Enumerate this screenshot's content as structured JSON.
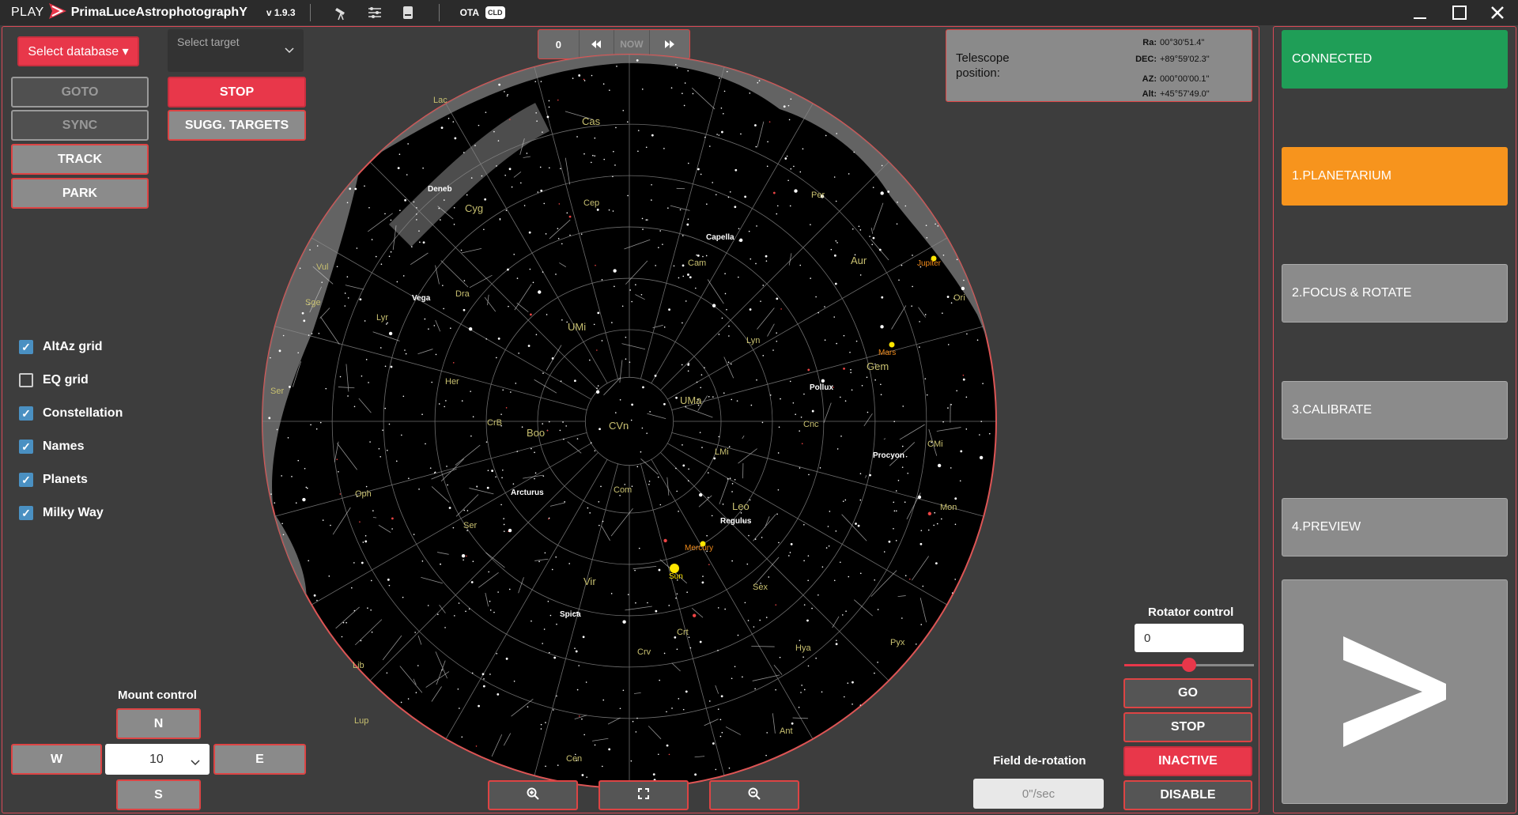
{
  "titlebar": {
    "play": "PLAY",
    "company": "PrimaLuceAstrophotographY",
    "version": "v 1.9.3",
    "ota": "OTA",
    "cld": "CLD"
  },
  "left": {
    "select_database": "Select database ▾",
    "select_target_placeholder": "Select target",
    "goto": "GOTO",
    "sync": "SYNC",
    "track": "TRACK",
    "park": "PARK",
    "stop": "STOP",
    "sugg_targets": "SUGG. TARGETS",
    "options": [
      {
        "label": "AltAz grid",
        "checked": true
      },
      {
        "label": "EQ grid",
        "checked": false
      },
      {
        "label": "Constellation",
        "checked": true
      },
      {
        "label": "Names",
        "checked": true
      },
      {
        "label": "Planets",
        "checked": true
      },
      {
        "label": "Milky Way",
        "checked": true
      }
    ],
    "mount_control": "Mount control",
    "n": "N",
    "s": "S",
    "w": "W",
    "e": "E",
    "speed_value": "10"
  },
  "timebar": {
    "count": "0",
    "now": "NOW"
  },
  "telescope": {
    "label": "Telescope position:",
    "ra_label": "Ra:",
    "ra": "00°30'51.4\"",
    "dec_label": "DEC:",
    "dec": "+89°59'02.3\"",
    "az_label": "AZ:",
    "az": "000°00'00.1\"",
    "alt_label": "Alt:",
    "alt": "+45°57'49.0\""
  },
  "sky_labels": {
    "constellations": [
      "Lac",
      "Cas",
      "Cyg",
      "Cep",
      "Per",
      "Cam",
      "Aur",
      "Vul",
      "Sge",
      "Lyr",
      "Dra",
      "UMi",
      "Lyn",
      "Ori",
      "Gem",
      "Her",
      "CrB",
      "Boo",
      "CVn",
      "UMa",
      "Cnc",
      "LMi",
      "CMi",
      "Ser",
      "Oph",
      "Com",
      "Leo",
      "Mon",
      "Ser",
      "Vir",
      "Sex",
      "Crt",
      "Crv",
      "Hya",
      "Pyx",
      "Lib",
      "Lup",
      "Ant",
      "Cen"
    ],
    "stars": [
      "Deneb",
      "Vega",
      "Capella",
      "Pollux",
      "Procyon",
      "Arcturus",
      "Regulus",
      "Spica"
    ],
    "planets": [
      "Jupiter",
      "Mars",
      "Mercury",
      "Sun"
    ]
  },
  "rotator": {
    "title": "Rotator control",
    "value": "0",
    "slider_fraction": 0.5,
    "go": "GO",
    "stop": "STOP",
    "inactive": "INACTIVE",
    "disable": "DISABLE"
  },
  "field_derotation": {
    "title": "Field de-rotation",
    "value": "0\"/sec"
  },
  "right": {
    "connected": "CONNECTED",
    "planetarium": "1.PLANETARIUM",
    "focus": "2.FOCUS & ROTATE",
    "calibrate": "3.CALIBRATE",
    "preview": "4.PREVIEW",
    "next": ">"
  },
  "colors": {
    "accent_red": "#e8374a",
    "orange": "#f7941d",
    "green": "#1f9e57"
  }
}
